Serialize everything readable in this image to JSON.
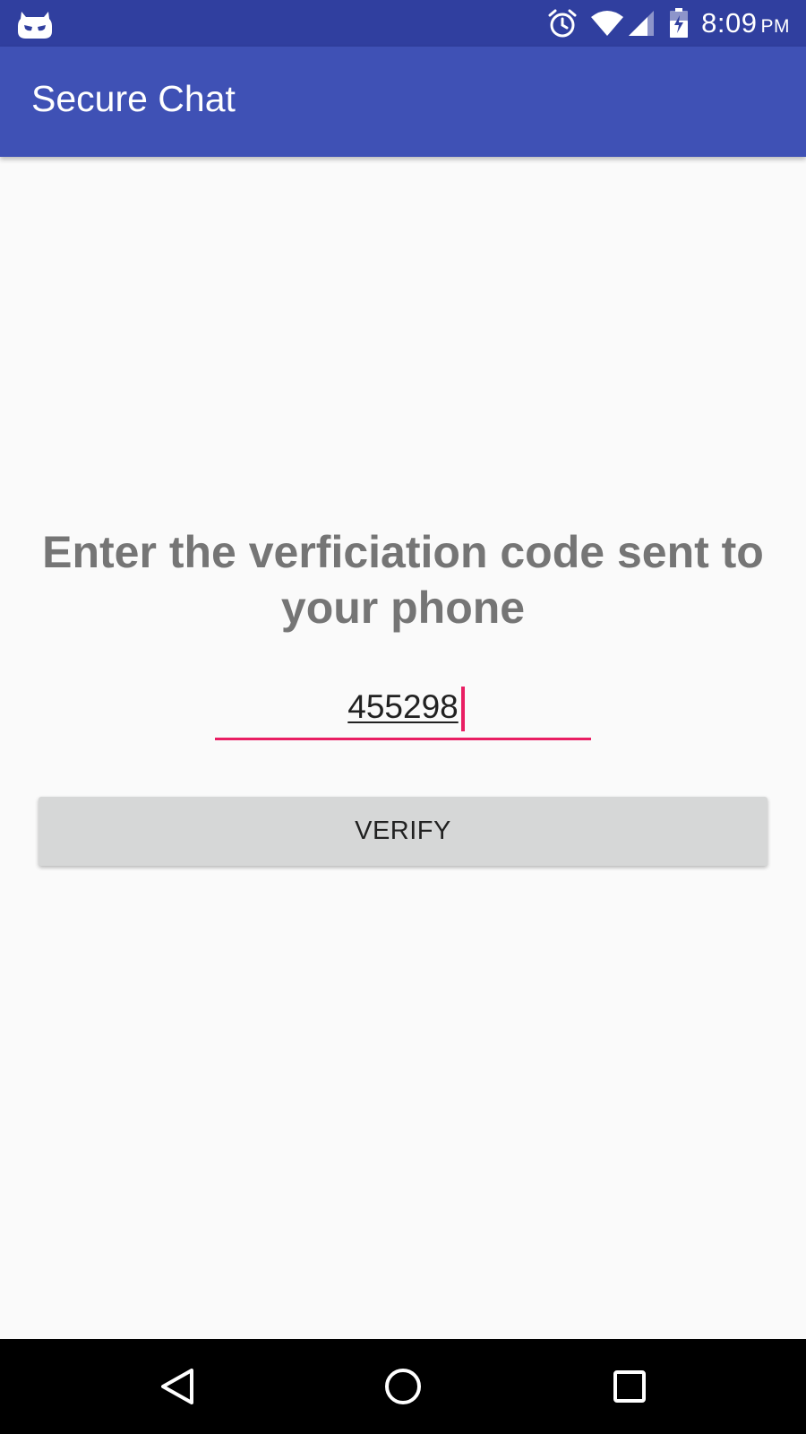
{
  "status_bar": {
    "icons": [
      "cyanogenmod-icon",
      "alarm-icon",
      "wifi-icon",
      "cell-signal-icon",
      "battery-charging-icon"
    ],
    "time": "8:09",
    "ampm": "PM",
    "color": "#303f9f"
  },
  "app_bar": {
    "title": "Secure Chat",
    "color": "#3f51b5"
  },
  "main": {
    "prompt": "Enter the verficiation code sent to your phone",
    "code_value": "455298",
    "accent_color": "#e91e63",
    "verify_label": "VERIFY"
  },
  "nav_bar": {
    "icons": [
      "back-icon",
      "home-icon",
      "recents-icon"
    ]
  }
}
